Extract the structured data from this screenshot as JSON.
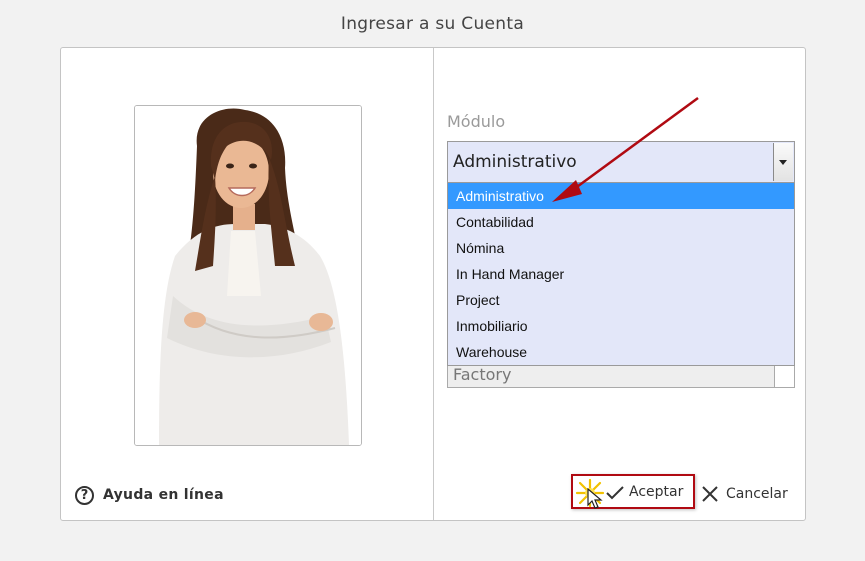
{
  "page": {
    "title": "Ingresar a su Cuenta"
  },
  "help": {
    "label": "Ayuda en línea",
    "icon": "help-circle-icon"
  },
  "module": {
    "label": "Módulo",
    "selected": "Administrativo",
    "options": [
      "Administrativo",
      "Contabilidad",
      "Nómina",
      "In Hand Manager",
      "Project",
      "Inmobiliario",
      "Warehouse"
    ],
    "highlighted_index": 0
  },
  "second_field": {
    "value": "Factory"
  },
  "buttons": {
    "accept_label": "Aceptar",
    "cancel_label": "Cancelar"
  },
  "colors": {
    "accent_highlight": "#3399ff",
    "annotation_red": "#b00a12",
    "dropdown_bg": "#e3e7f9"
  }
}
